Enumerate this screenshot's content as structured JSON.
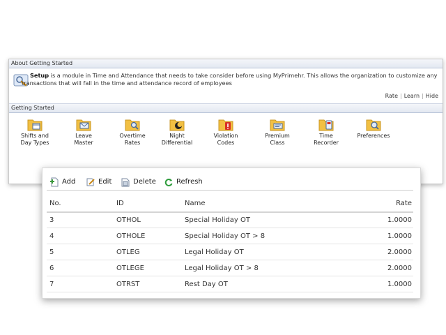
{
  "about": {
    "header": "About Getting Started",
    "setup_bold": "Setup",
    "setup_text": " is a module in Time and Attendance that needs to take consider before using MyPrimehr. This allows the organization to customize any transactions that will fall in the time and attendance record of employees",
    "links": [
      "Rate",
      "Learn",
      "Hide"
    ]
  },
  "getting_started": {
    "header": "Getting Started",
    "items": [
      {
        "label": "Shifts and\nDay Types",
        "icon": "folder-calendar-icon"
      },
      {
        "label": "Leave\nMaster",
        "icon": "folder-mail-icon"
      },
      {
        "label": "Overtime\nRates",
        "icon": "folder-search-icon"
      },
      {
        "label": "Night\nDifferential",
        "icon": "folder-moon-icon"
      },
      {
        "label": "Violation\nCodes",
        "icon": "folder-alert-icon"
      },
      {
        "label": "Premium\nClass",
        "icon": "folder-class-icon"
      },
      {
        "label": "Time\nRecorder",
        "icon": "folder-recorder-icon"
      },
      {
        "label": "Preferences",
        "icon": "folder-preferences-icon"
      }
    ]
  },
  "toolbar": {
    "add": "Add",
    "edit": "Edit",
    "delete": "Delete",
    "refresh": "Refresh"
  },
  "grid": {
    "columns": {
      "no": "No.",
      "id": "ID",
      "name": "Name",
      "rate": "Rate"
    },
    "rows": [
      {
        "no": "3",
        "id": "OTHOL",
        "name": "Special Holiday OT",
        "rate": "1.0000"
      },
      {
        "no": "4",
        "id": "OTHOLE",
        "name": "Special Holiday OT > 8",
        "rate": "1.0000"
      },
      {
        "no": "5",
        "id": "OTLEG",
        "name": "Legal Holiday OT",
        "rate": "2.0000"
      },
      {
        "no": "6",
        "id": "OTLEGE",
        "name": "Legal Holiday OT > 8",
        "rate": "2.0000"
      },
      {
        "no": "7",
        "id": "OTRST",
        "name": "Rest Day OT",
        "rate": "1.0000"
      }
    ]
  },
  "colors": {
    "folder": "#f2c043",
    "header_border": "#b8c4d8",
    "add_green": "#3a9a3a",
    "refresh_green": "#2e9c3c"
  }
}
